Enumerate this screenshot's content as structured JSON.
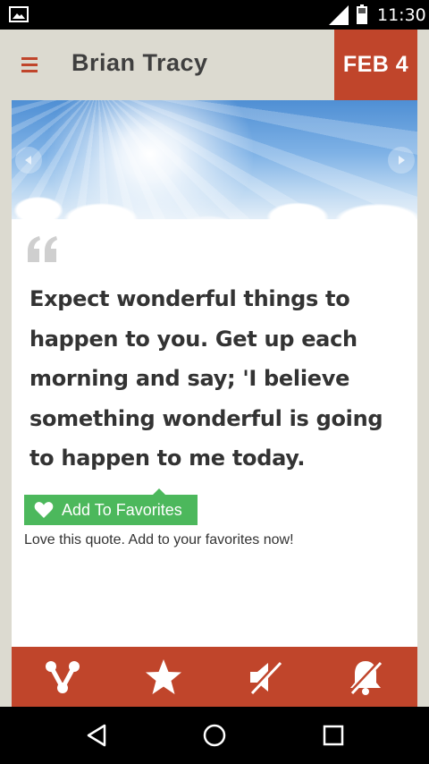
{
  "status_bar": {
    "time": "11:30",
    "icons": [
      "image-notification-icon",
      "signal-icon",
      "battery-icon"
    ]
  },
  "header": {
    "menu_icon": "hamburger-menu-icon",
    "title": "Brian Tracy",
    "date": "FEB 4"
  },
  "hero": {
    "prev_icon": "chevron-left-icon",
    "next_icon": "chevron-right-icon"
  },
  "quote": {
    "mark_icon": "open-quote-icon",
    "text": "Expect wonderful things to happen to you. Get up each morning and say; 'I believe something wonderful is going to happen to me today."
  },
  "favorites": {
    "button_label": "Add To Favorites",
    "prompt": "Love this quote. Add to your favorites now!",
    "icon": "heart-icon"
  },
  "toolbar": {
    "items": [
      {
        "icon": "share-icon"
      },
      {
        "icon": "star-icon"
      },
      {
        "icon": "sound-off-icon"
      },
      {
        "icon": "notifications-off-icon"
      }
    ]
  },
  "nav_bar": {
    "items": [
      {
        "icon": "back-triangle-icon"
      },
      {
        "icon": "home-circle-icon"
      },
      {
        "icon": "recents-square-icon"
      }
    ]
  },
  "colors": {
    "accent": "#c0452b",
    "background": "#dcdad0",
    "favorite": "#4cb85c"
  }
}
